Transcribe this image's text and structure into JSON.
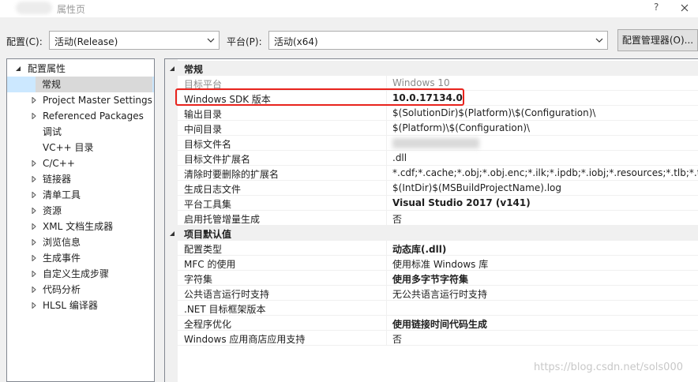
{
  "window": {
    "title": "属性页",
    "help_label": "?"
  },
  "toolbar": {
    "config_label": "配置(C):",
    "config_value": "活动(Release)",
    "platform_label": "平台(P):",
    "platform_value": "活动(x64)",
    "manager_button": "配置管理器(O)..."
  },
  "tree": {
    "root": "配置属性",
    "items": [
      {
        "label": "常规",
        "selected": true,
        "expandable": false
      },
      {
        "label": "Project Master Settings",
        "expandable": true
      },
      {
        "label": "Referenced Packages",
        "expandable": true
      },
      {
        "label": "调试",
        "expandable": false
      },
      {
        "label": "VC++ 目录",
        "expandable": false
      },
      {
        "label": "C/C++",
        "expandable": true
      },
      {
        "label": "链接器",
        "expandable": true
      },
      {
        "label": "清单工具",
        "expandable": true
      },
      {
        "label": "资源",
        "expandable": true
      },
      {
        "label": "XML 文档生成器",
        "expandable": true
      },
      {
        "label": "浏览信息",
        "expandable": true
      },
      {
        "label": "生成事件",
        "expandable": true
      },
      {
        "label": "自定义生成步骤",
        "expandable": true
      },
      {
        "label": "代码分析",
        "expandable": true
      },
      {
        "label": "HLSL 编译器",
        "expandable": true
      }
    ]
  },
  "grid": {
    "general": {
      "title": "常规",
      "rows": [
        {
          "name": "目标平台",
          "value": "Windows 10"
        },
        {
          "name": "Windows SDK 版本",
          "value": "10.0.17134.0"
        },
        {
          "name": "输出目录",
          "value": "$(SolutionDir)$(Platform)\\$(Configuration)\\"
        },
        {
          "name": "中间目录",
          "value": "$(Platform)\\$(Configuration)\\"
        },
        {
          "name": "目标文件名",
          "value": ""
        },
        {
          "name": "目标文件扩展名",
          "value": ".dll"
        },
        {
          "name": "清除时要删除的扩展名",
          "value": "*.cdf;*.cache;*.obj;*.obj.enc;*.ilk;*.ipdb;*.iobj;*.resources;*.tlb;*.tli;*.tlh"
        },
        {
          "name": "生成日志文件",
          "value": "$(IntDir)$(MSBuildProjectName).log"
        },
        {
          "name": "平台工具集",
          "value": "Visual Studio 2017 (v141)"
        },
        {
          "name": "启用托管增量生成",
          "value": "否"
        }
      ]
    },
    "defaults": {
      "title": "项目默认值",
      "rows": [
        {
          "name": "配置类型",
          "value": "动态库(.dll)"
        },
        {
          "name": "MFC 的使用",
          "value": "使用标准 Windows 库"
        },
        {
          "name": "字符集",
          "value": "使用多字节字符集"
        },
        {
          "name": "公共语言运行时支持",
          "value": "无公共语言运行时支持"
        },
        {
          "name": ".NET 目标框架版本",
          "value": ""
        },
        {
          "name": "全程序优化",
          "value": "使用链接时间代码生成"
        },
        {
          "name": "Windows 应用商店应用支持",
          "value": "否"
        }
      ]
    }
  },
  "watermark": "https://blog.csdn.net/sols000",
  "colors": {
    "highlight": "#e8231d",
    "selection": "#cce8ff"
  }
}
